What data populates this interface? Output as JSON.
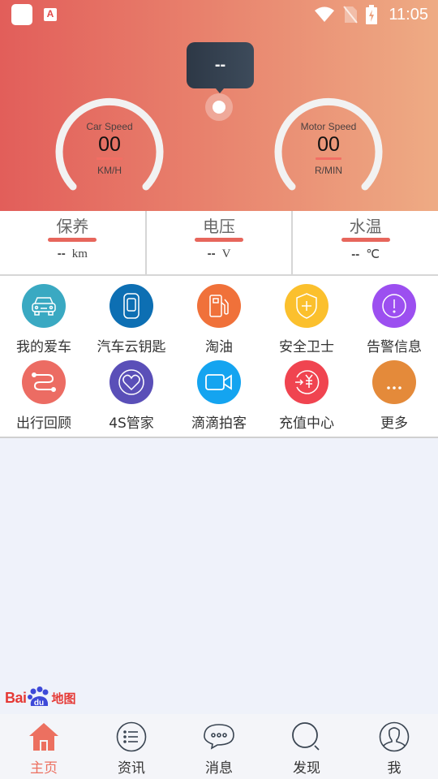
{
  "status_bar": {
    "time": "11:05",
    "app_icon_2_letter": "A"
  },
  "header": {
    "tooltip_value": "--",
    "gauges": [
      {
        "title": "Car Speed",
        "value": "00",
        "unit": "KM/H"
      },
      {
        "title": "Motor Speed",
        "value": "00",
        "unit": "R/MIN"
      }
    ]
  },
  "stats": [
    {
      "label": "保养",
      "value": "--",
      "unit": "km"
    },
    {
      "label": "电压",
      "value": "--",
      "unit": "V"
    },
    {
      "label": "水温",
      "value": "--",
      "unit": "℃"
    }
  ],
  "menu": [
    {
      "label": "我的爱车",
      "icon": "car-icon",
      "color": "#3aa9c2"
    },
    {
      "label": "汽车云钥匙",
      "icon": "car-key-icon",
      "color": "#0d6fb3"
    },
    {
      "label": "淘油",
      "icon": "fuel-pump-icon",
      "color": "#f0713a"
    },
    {
      "label": "安全卫士",
      "icon": "shield-plus-icon",
      "color": "#fbc02d"
    },
    {
      "label": "告警信息",
      "icon": "alert-icon",
      "color": "#9c4ff0"
    },
    {
      "label": "出行回顾",
      "icon": "route-icon",
      "color": "#ec6c63"
    },
    {
      "label": "4S管家",
      "icon": "heart-icon",
      "color": "#5a4fb8"
    },
    {
      "label": "滴滴拍客",
      "icon": "video-camera-icon",
      "color": "#14a4f0"
    },
    {
      "label": "充值中心",
      "icon": "recharge-yuan-icon",
      "color": "#f04450"
    },
    {
      "label": "更多",
      "icon": "more-icon",
      "color": "#e48a3a"
    }
  ],
  "map": {
    "logo_text": "Bai",
    "logo_du": "du",
    "logo_suffix": "地图"
  },
  "nav": [
    {
      "label": "主页",
      "icon": "home-icon",
      "active": true
    },
    {
      "label": "资讯",
      "icon": "list-icon",
      "active": false
    },
    {
      "label": "消息",
      "icon": "chat-bubble-icon",
      "active": false
    },
    {
      "label": "发现",
      "icon": "search-icon",
      "active": false
    },
    {
      "label": "我",
      "icon": "profile-icon",
      "active": false
    }
  ],
  "colors": {
    "accent": "#ec7060",
    "header_start": "#e25e5a",
    "header_end": "#eeab84"
  }
}
